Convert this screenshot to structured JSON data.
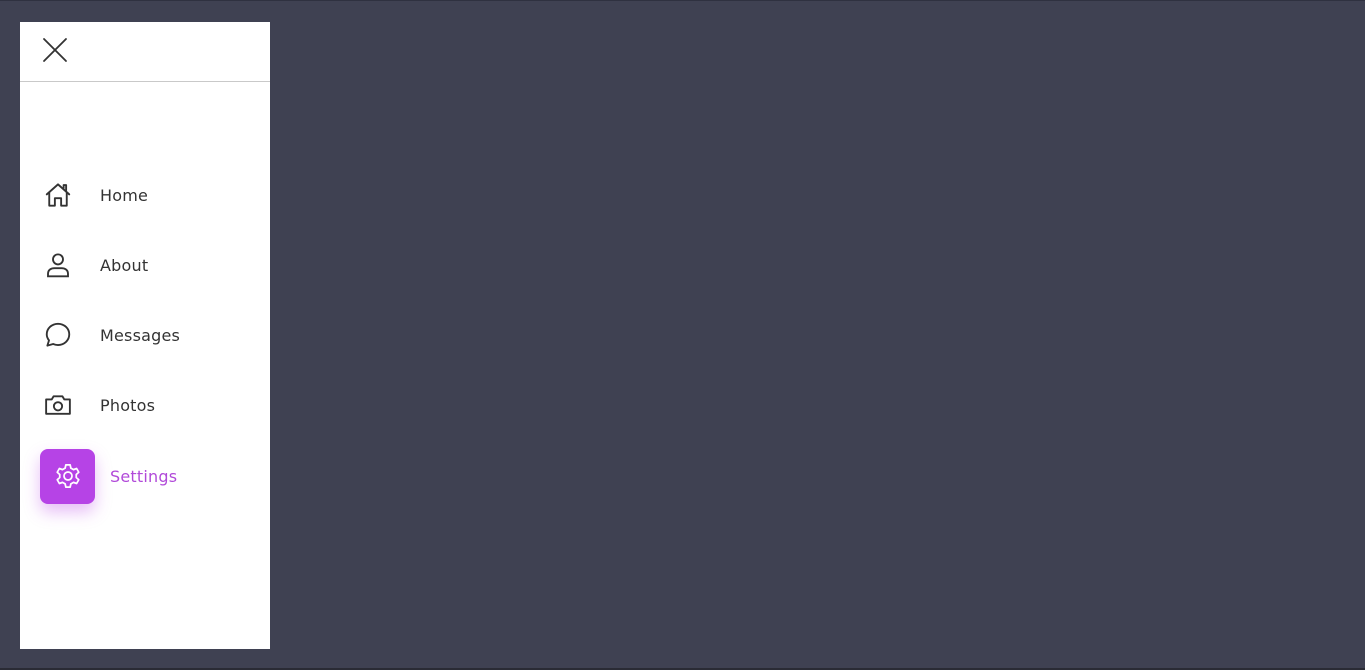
{
  "sidebar": {
    "close_icon": "close-icon",
    "items": [
      {
        "label": "Home",
        "icon": "home-icon",
        "active": false
      },
      {
        "label": "About",
        "icon": "user-icon",
        "active": false
      },
      {
        "label": "Messages",
        "icon": "chat-icon",
        "active": false
      },
      {
        "label": "Photos",
        "icon": "camera-icon",
        "active": false
      },
      {
        "label": "Settings",
        "icon": "gear-icon",
        "active": true
      }
    ]
  },
  "colors": {
    "background": "#3f4152",
    "accent": "#b643e6",
    "accent_text": "#b14ad9",
    "text": "#333333"
  }
}
